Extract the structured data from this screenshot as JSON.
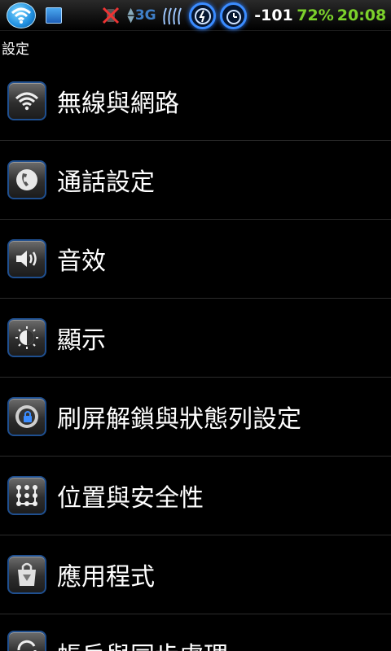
{
  "status_bar": {
    "network_type": "3G",
    "signal": "-101",
    "battery": "72%",
    "time": "20:08",
    "icons": [
      "wifi-icon",
      "usb-icon",
      "mute-icon",
      "signal-wave-icon",
      "charging-clock-icon",
      "alarm-clock-icon"
    ]
  },
  "page": {
    "title": "設定"
  },
  "settings": [
    {
      "label": "無線與網路",
      "icon": "wifi-icon"
    },
    {
      "label": "通話設定",
      "icon": "phone-icon"
    },
    {
      "label": "音效",
      "icon": "speaker-icon"
    },
    {
      "label": "顯示",
      "icon": "brightness-icon"
    },
    {
      "label": "刷屏解鎖與狀態列設定",
      "icon": "lock-icon"
    },
    {
      "label": "位置與安全性",
      "icon": "pattern-lock-icon"
    },
    {
      "label": "應用程式",
      "icon": "market-bag-icon"
    },
    {
      "label": "帳戶與同步處理",
      "icon": "sync-icon"
    }
  ],
  "colors": {
    "accent_green": "#7cd12b",
    "icon_border": "#1f4f8f",
    "divider": "#2c2c2c"
  }
}
